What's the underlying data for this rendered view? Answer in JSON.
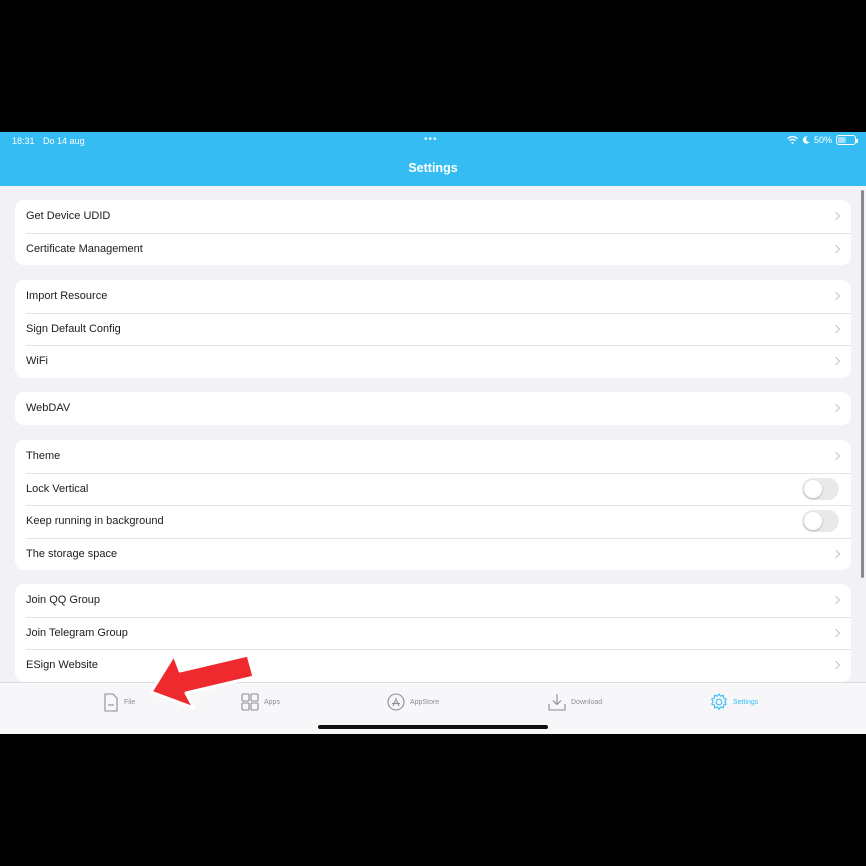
{
  "status_bar": {
    "time": "18:31",
    "date": "Do 14 aug",
    "battery": "50%",
    "battery_level": 0.5
  },
  "header": {
    "title": "Settings"
  },
  "groups": [
    {
      "rows": [
        {
          "label": "Get Device UDID",
          "accessory": "chevron"
        },
        {
          "label": "Certificate Management",
          "accessory": "chevron"
        }
      ]
    },
    {
      "rows": [
        {
          "label": "Import Resource",
          "accessory": "chevron"
        },
        {
          "label": "Sign Default Config",
          "accessory": "chevron"
        },
        {
          "label": "WiFi",
          "accessory": "chevron"
        }
      ]
    },
    {
      "rows": [
        {
          "label": "WebDAV",
          "accessory": "chevron"
        }
      ]
    },
    {
      "rows": [
        {
          "label": "Theme",
          "accessory": "chevron"
        },
        {
          "label": "Lock Vertical",
          "accessory": "toggle",
          "on": false
        },
        {
          "label": "Keep running in background",
          "accessory": "toggle",
          "on": false
        },
        {
          "label": "The storage space",
          "accessory": "chevron"
        }
      ]
    },
    {
      "rows": [
        {
          "label": "Join QQ Group",
          "accessory": "chevron"
        },
        {
          "label": "Join Telegram Group",
          "accessory": "chevron"
        },
        {
          "label": "ESign Website",
          "accessory": "chevron"
        }
      ]
    }
  ],
  "tabbar": {
    "tabs": [
      {
        "label": "File",
        "icon": "file-icon",
        "active": false
      },
      {
        "label": "Apps",
        "icon": "apps-grid-icon",
        "active": false
      },
      {
        "label": "AppStore",
        "icon": "appstore-icon",
        "active": false
      },
      {
        "label": "Download",
        "icon": "download-icon",
        "active": false
      },
      {
        "label": "Settings",
        "icon": "gear-icon",
        "active": true
      }
    ]
  },
  "colors": {
    "accent": "#35bdf3",
    "annotation_arrow": "#ee2a2f",
    "background": "#f2f2f6"
  }
}
